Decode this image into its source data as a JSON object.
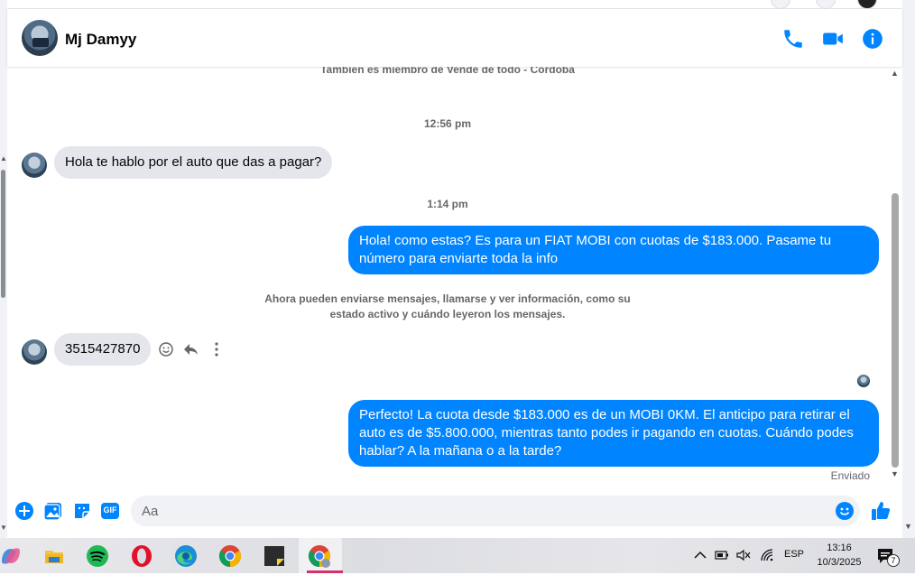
{
  "conversation": {
    "contact_name": "Mj Damyy",
    "group_notice": "También es miembro de Vende de todo - Córdoba",
    "messages": [
      {
        "type": "timestamp",
        "text": "12:56 pm"
      },
      {
        "type": "incoming",
        "text": "Hola te hablo por el auto que das a pagar?"
      },
      {
        "type": "timestamp",
        "text": "1:14 pm"
      },
      {
        "type": "outgoing",
        "text": "Hola! como estas? Es para un FIAT MOBI con cuotas de $183.000. Pasame tu número para enviarte toda la info"
      },
      {
        "type": "notice",
        "text": "Ahora pueden enviarse mensajes, llamarse y ver información, como su estado activo y cuándo leyeron los mensajes."
      },
      {
        "type": "incoming",
        "text": "3515427870"
      },
      {
        "type": "outgoing",
        "text": "Perfecto! La cuota desde $183.000 es de un MOBI 0KM. El anticipo para retirar el auto es de $5.800.000, mientras tanto podes ir pagando en cuotas. Cuándo podes hablar? A la mañana o a la tarde?"
      }
    ],
    "sent_status": "Enviado"
  },
  "composer": {
    "placeholder": "Aa",
    "icons": [
      "plus-circle-icon",
      "image-icon",
      "sticker-icon",
      "gif-icon",
      "emoji-icon",
      "thumbs-up-icon"
    ],
    "gif_label": "GIF"
  },
  "header_icons": [
    "phone-icon",
    "video-icon",
    "info-icon"
  ],
  "message_action_icons": [
    "emoji-react-icon",
    "reply-icon",
    "more-icon"
  ],
  "taskbar": {
    "apps": [
      "copilot-icon",
      "file-explorer-icon",
      "spotify-icon",
      "opera-icon",
      "edge-icon",
      "chrome-icon",
      "sticky-notes-icon",
      "chrome-active-icon"
    ],
    "language": "ESP",
    "time": "13:16",
    "date": "10/3/2025",
    "notification_count": "7"
  },
  "colors": {
    "accent": "#0084ff",
    "incoming_bubble": "#e4e6eb",
    "muted_text": "#65676b"
  }
}
